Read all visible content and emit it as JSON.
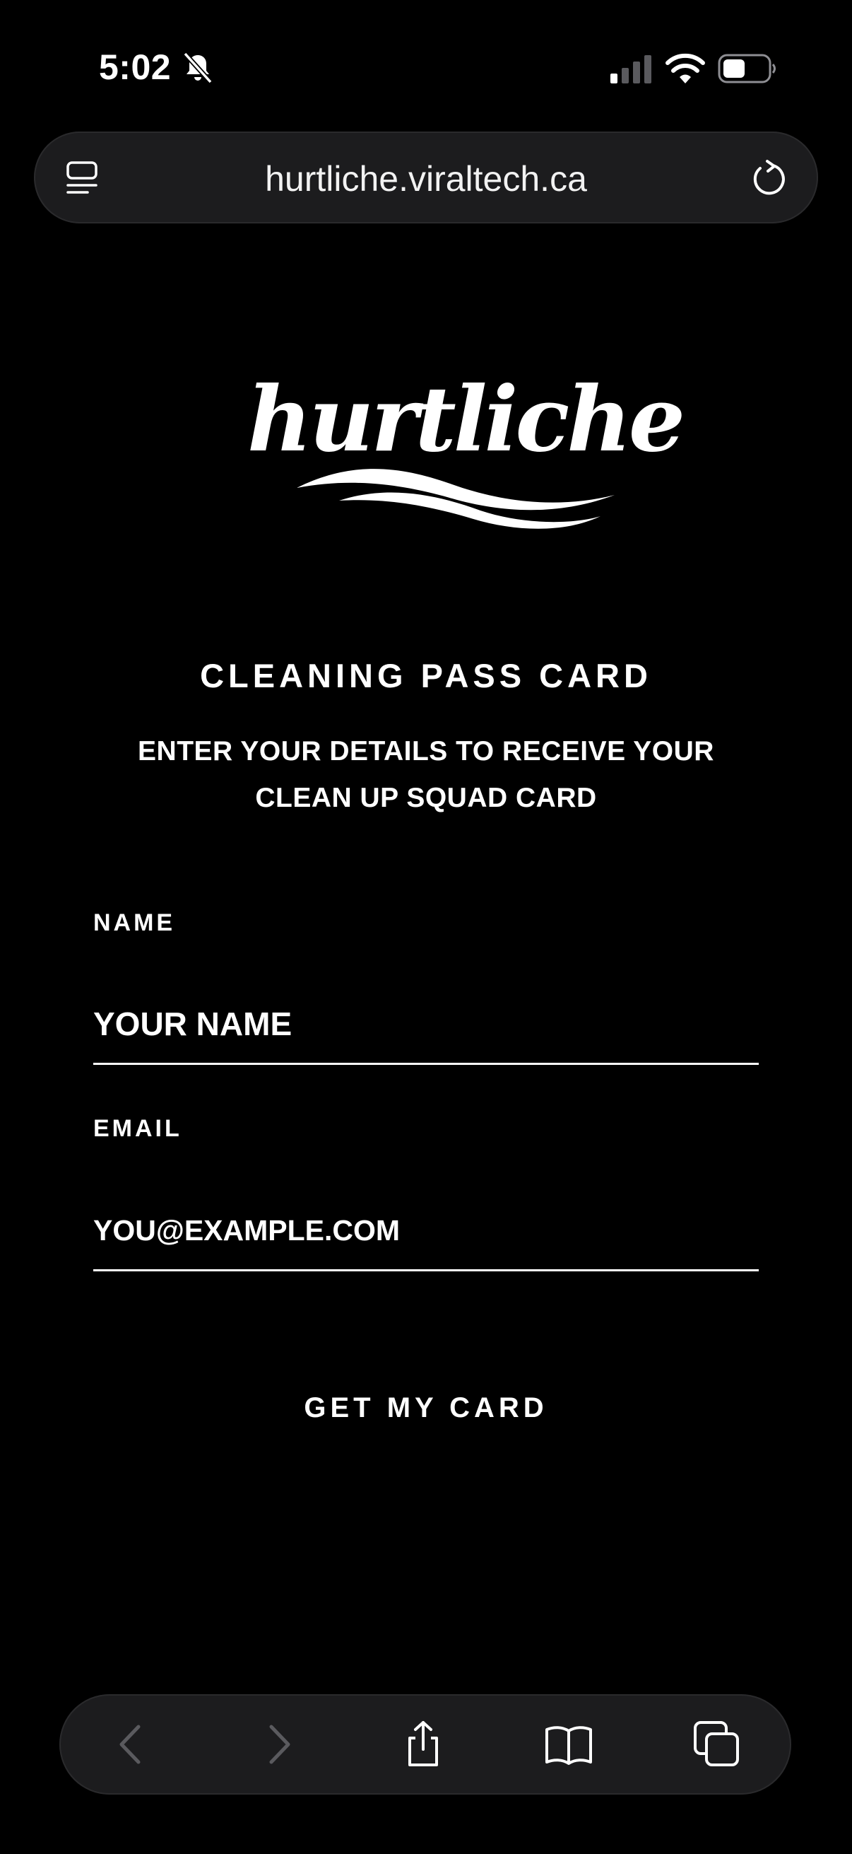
{
  "status_bar": {
    "time": "5:02"
  },
  "browser": {
    "url": "hurtliche.viraltech.ca"
  },
  "logo": {
    "text": "hurtliche"
  },
  "page": {
    "title": "CLEANING PASS CARD",
    "subtitle": "ENTER YOUR DETAILS TO RECEIVE YOUR CLEAN UP SQUAD CARD"
  },
  "form": {
    "name": {
      "label": "NAME",
      "placeholder": "YOUR NAME",
      "value": ""
    },
    "email": {
      "label": "EMAIL",
      "placeholder": "YOU@EXAMPLE.COM",
      "value": ""
    },
    "submit_label": "GET MY CARD"
  },
  "toolbar": {
    "icons": [
      "back-icon",
      "forward-icon",
      "share-icon",
      "bookmarks-icon",
      "tabs-icon"
    ]
  },
  "colors": {
    "background": "#000000",
    "bar_background": "#1c1c1e",
    "text": "#ffffff",
    "disabled_icon": "#5a5a5e"
  }
}
